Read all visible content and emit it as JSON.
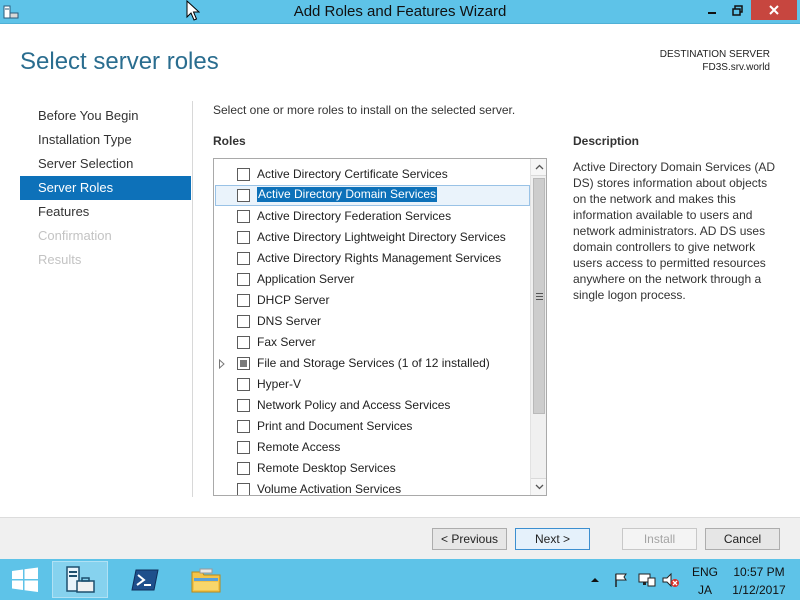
{
  "window": {
    "title": "Add Roles and Features Wizard"
  },
  "header": {
    "title": "Select server roles",
    "destination_label": "DESTINATION SERVER",
    "destination_value": "FD3S.srv.world"
  },
  "nav": {
    "items": [
      {
        "label": "Before You Begin",
        "state": "normal"
      },
      {
        "label": "Installation Type",
        "state": "normal"
      },
      {
        "label": "Server Selection",
        "state": "normal"
      },
      {
        "label": "Server Roles",
        "state": "active"
      },
      {
        "label": "Features",
        "state": "normal"
      },
      {
        "label": "Confirmation",
        "state": "disabled"
      },
      {
        "label": "Results",
        "state": "disabled"
      }
    ]
  },
  "main": {
    "instruction": "Select one or more roles to install on the selected server.",
    "roles_header": "Roles",
    "roles": [
      {
        "label": "Active Directory Certificate Services",
        "checked": false,
        "selected": false
      },
      {
        "label": "Active Directory Domain Services",
        "checked": false,
        "selected": true
      },
      {
        "label": "Active Directory Federation Services",
        "checked": false,
        "selected": false
      },
      {
        "label": "Active Directory Lightweight Directory Services",
        "checked": false,
        "selected": false
      },
      {
        "label": "Active Directory Rights Management Services",
        "checked": false,
        "selected": false
      },
      {
        "label": "Application Server",
        "checked": false,
        "selected": false
      },
      {
        "label": "DHCP Server",
        "checked": false,
        "selected": false
      },
      {
        "label": "DNS Server",
        "checked": false,
        "selected": false
      },
      {
        "label": "Fax Server",
        "checked": false,
        "selected": false
      },
      {
        "label": "File and Storage Services (1 of 12 installed)",
        "checked": "partial",
        "expandable": true,
        "selected": false
      },
      {
        "label": "Hyper-V",
        "checked": false,
        "selected": false
      },
      {
        "label": "Network Policy and Access Services",
        "checked": false,
        "selected": false
      },
      {
        "label": "Print and Document Services",
        "checked": false,
        "selected": false
      },
      {
        "label": "Remote Access",
        "checked": false,
        "selected": false
      },
      {
        "label": "Remote Desktop Services",
        "checked": false,
        "selected": false
      },
      {
        "label": "Volume Activation Services",
        "checked": false,
        "selected": false
      }
    ],
    "description_header": "Description",
    "description": "Active Directory Domain Services (AD DS) stores information about objects on the network and makes this information available to users and network administrators. AD DS uses domain controllers to give network users access to permitted resources anywhere on the network through a single logon process."
  },
  "buttons": {
    "previous": "< Previous",
    "next": "Next >",
    "install": "Install",
    "cancel": "Cancel"
  },
  "taskbar": {
    "lang_top": "ENG",
    "lang_bottom": "JA",
    "time": "10:57 PM",
    "date": "1/12/2017"
  },
  "colors": {
    "accent": "#0d71b9",
    "titlebar": "#5ec3e8",
    "heading": "#2a6d8f",
    "close_button": "#c7463f"
  }
}
